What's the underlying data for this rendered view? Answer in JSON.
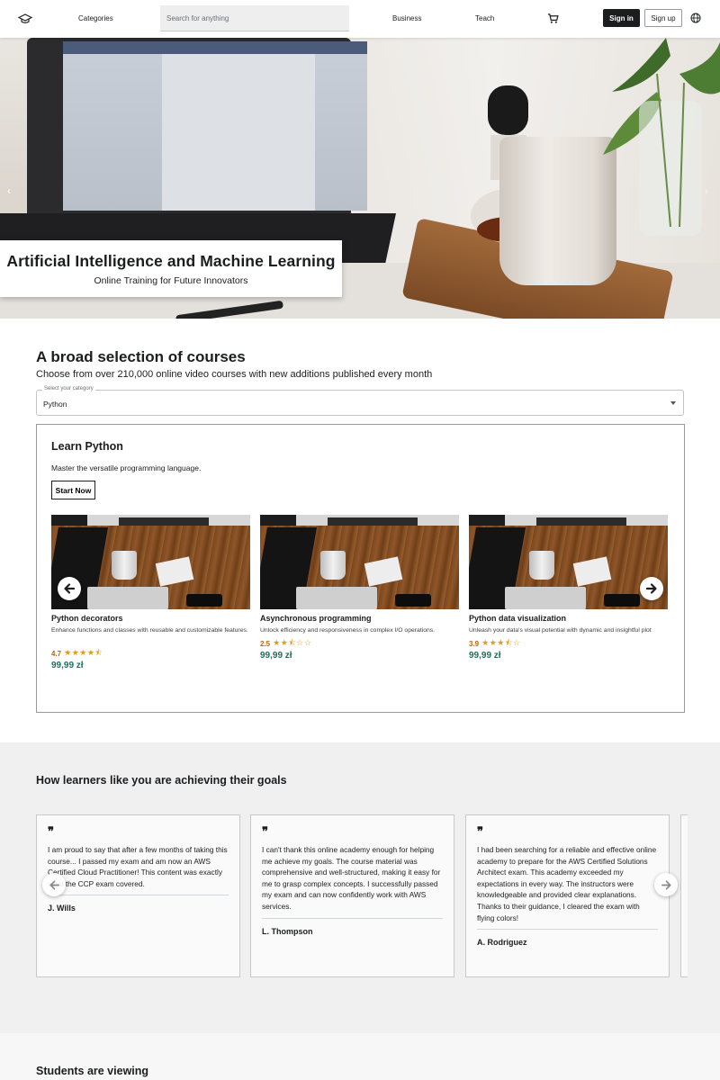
{
  "header": {
    "categories_label": "Categories",
    "search_placeholder": "Search for anything",
    "business_label": "Business",
    "teach_label": "Teach",
    "signin_label": "Sign in",
    "signup_label": "Sign up",
    "icons": [
      "graduation-cap-icon",
      "shopping-cart-icon",
      "globe-icon"
    ]
  },
  "hero": {
    "title": "Artificial Intelligence and Machine Learning",
    "subtitle": "Online Training for Future Innovators"
  },
  "courses_section": {
    "title": "A broad selection of courses",
    "subtitle": "Choose from over 210,000 online video courses with new additions published every month",
    "select_label": "Select your category",
    "select_value": "Python",
    "box": {
      "title": "Learn Python",
      "description": "Master the versatile programming language.",
      "start_label": "Start Now"
    },
    "courses": [
      {
        "name": "Python decorators",
        "description": "Enhance functions and classes with reusable and customizable features.",
        "rating": "4.7",
        "stars": "★★★★⯪",
        "price": "99,99 zł"
      },
      {
        "name": "Asynchronous programming",
        "description": "Unlock efficiency and responsiveness in complex I/O operations.",
        "rating": "2.5",
        "stars": "★★⯪☆☆",
        "price": "99,99 zł"
      },
      {
        "name": "Python data visualization",
        "description": "Unleash your data's visual potential with dynamic and insightful plot",
        "rating": "3.9",
        "stars": "★★★⯪☆",
        "price": "99,99 zł"
      }
    ]
  },
  "testimonials": {
    "title": "How learners like you are achieving their goals",
    "items": [
      {
        "text": "I am proud to say that after a few months of taking this course... I passed my exam and am now an AWS Certified Cloud Practitioner! This content was exactly what the CCP exam covered.",
        "name": "J. Wills"
      },
      {
        "text": "I can't thank this online academy enough for helping me achieve my goals. The course material was comprehensive and well-structured, making it easy for me to grasp complex concepts. I successfully passed my exam and can now confidently work with AWS services.",
        "name": "L. Thompson"
      },
      {
        "text": "I had been searching for a reliable and effective online academy to prepare for the AWS Certified Solutions Architect exam. This academy exceeded my expectations in every way. The instructors were knowledgeable and provided clear explanations. Thanks to their guidance, I cleared the exam with flying colors!",
        "name": "A. Rodriguez"
      }
    ]
  },
  "students_section": {
    "title": "Students are viewing"
  },
  "colors": {
    "dark": "#1c1d1f",
    "price_green": "#1e6f5c",
    "rating_orange": "#b4690e",
    "star_gold": "#e59819",
    "testimonial_bg": "#f0f0f0"
  }
}
